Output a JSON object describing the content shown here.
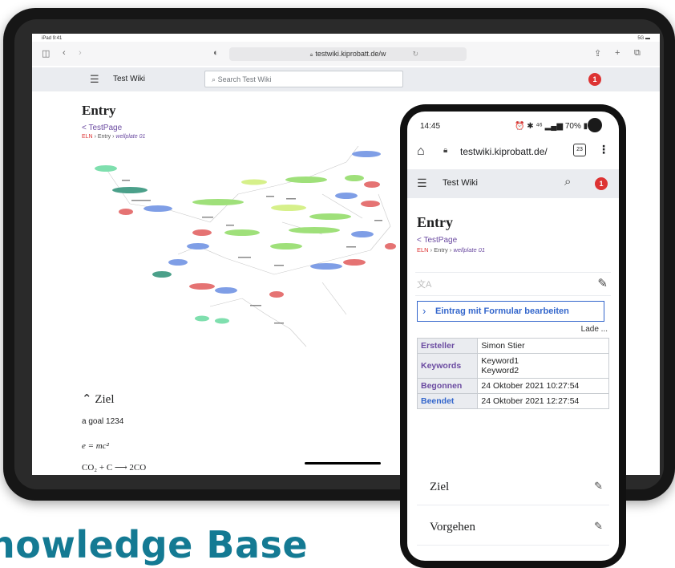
{
  "ipad": {
    "status": {
      "time": "iPad 9:41",
      "battery": "5G"
    },
    "browser": {
      "url": "testwiki.kiprobatt.de/w"
    },
    "wiki": {
      "site_title": "Test Wiki",
      "search_placeholder": "Search Test Wiki",
      "notification_count": "1"
    },
    "page": {
      "title": "Entry",
      "back_link": "< TestPage",
      "breadcrumb": {
        "root": "ELN",
        "middle": " › Entry › ",
        "current": "wellplate 01"
      },
      "section_title": "Ziel",
      "goal_text": "a goal 1234",
      "formula1": "e = mc²",
      "formula2": "CO₂ + C ⟶ 2CO"
    }
  },
  "phone": {
    "status": {
      "time": "14:45",
      "battery": "70%"
    },
    "browser": {
      "url": "testwiki.kiprobatt.de/",
      "tab_count": "23"
    },
    "wiki": {
      "site_title": "Test Wiki",
      "notification_count": "1"
    },
    "page": {
      "title": "Entry",
      "back_link": "< TestPage",
      "breadcrumb": {
        "root": "ELN",
        "middle": " › Entry › ",
        "current": "wellplate 01"
      },
      "edit_button": "Eintrag mit Formular bearbeiten",
      "loading": "Lade ...",
      "properties": [
        {
          "key": "Ersteller",
          "value": "Simon Stier"
        },
        {
          "key": "Keywords",
          "value1": "Keyword1",
          "value2": "Keyword2"
        },
        {
          "key": "Begonnen",
          "value": "24 Oktober 2021 10:27:54"
        },
        {
          "key": "Beendet",
          "value": "24 Oktober 2021 12:27:54"
        }
      ],
      "sections": [
        "Ziel",
        "Vorgehen"
      ]
    }
  },
  "banner": "nowledge Base",
  "colors": {
    "accent": "#147a93",
    "link": "#6b4ba1",
    "badge": "#dd3333"
  }
}
